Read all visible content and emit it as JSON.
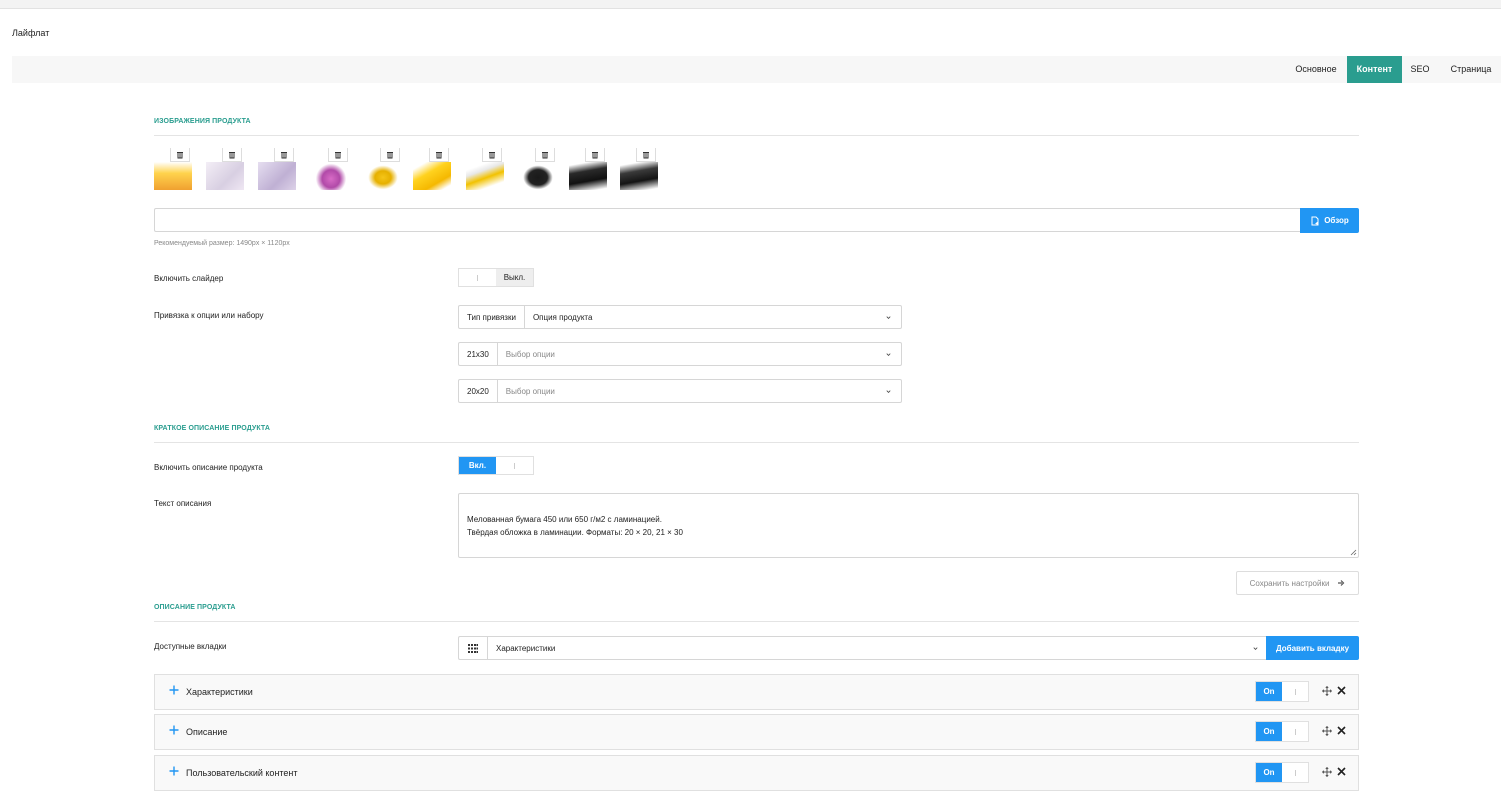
{
  "page": {
    "title": "Лайфлат"
  },
  "tabs": [
    {
      "label": "Основное",
      "active": false
    },
    {
      "label": "Контент",
      "active": true
    },
    {
      "label": "SEO",
      "active": false
    },
    {
      "label": "Страница",
      "active": false
    }
  ],
  "images_section": {
    "title": "ИЗОБРАЖЕНИЯ ПРОДУКТА",
    "thumbnails_count": 10,
    "browse_label": "Обзор",
    "file_value": "",
    "hint": "Рекомендуемый размер: 1490px × 1120px"
  },
  "slider": {
    "label": "Включить слайдер",
    "state_label": "Выкл."
  },
  "binding": {
    "label": "Привязка к опции или набору",
    "type_addon": "Тип привязки",
    "type_value": "Опция продукта",
    "rows": [
      {
        "addon": "21x30",
        "placeholder": "Выбор опции"
      },
      {
        "addon": "20x20",
        "placeholder": "Выбор опции"
      }
    ]
  },
  "short_desc": {
    "title": "КРАТКОЕ ОПИСАНИЕ ПРОДУКТА",
    "enable_label": "Включить описание продукта",
    "enable_state": "Вкл.",
    "text_label": "Текст описания",
    "text_value": "Мелованная бумага 450 или 650 г/м2 с ламинацией.\nТвёрдая обложка в ламинации. Форматы: 20 × 20, 21 × 30",
    "save_label": "Сохранить настройки"
  },
  "description": {
    "title": "ОПИСАНИЕ ПРОДУКТА",
    "tabs_label": "Доступные вкладки",
    "tabs_value": "Характеристики",
    "add_tab_label": "Добавить вкладку",
    "panels": [
      {
        "title": "Характеристики",
        "toggle": "On"
      },
      {
        "title": "Описание",
        "toggle": "On"
      },
      {
        "title": "Пользовательский контент",
        "toggle": "On"
      }
    ]
  },
  "colors": {
    "accent_teal": "#2a9d8f",
    "primary_blue": "#2196f3"
  },
  "icons": {
    "thumb_delete": "trash-icon",
    "browse": "file-add-icon",
    "save": "arrow-right-icon",
    "grid": "grid-icon",
    "panel_expand": "plus-icon",
    "panel_move": "move-icon",
    "panel_close": "close-icon",
    "select_arrow": "chevron-down-icon"
  }
}
